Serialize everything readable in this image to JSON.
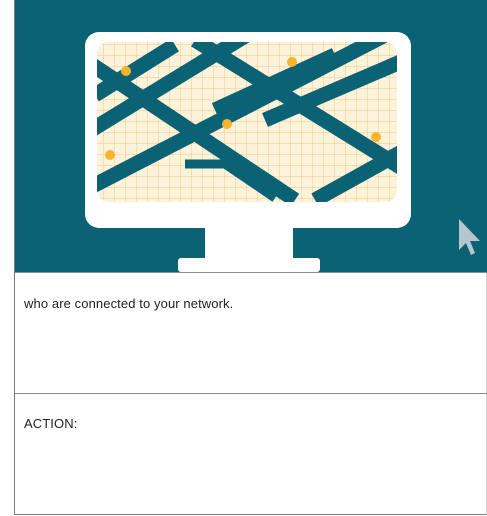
{
  "illustration": {
    "icon": "monitor-network-icon",
    "colors": {
      "background": "#0c6275",
      "monitor": "#ffffff",
      "screen_grid": "#f5ddb0",
      "paths": "#0c6275",
      "nodes": "#f6b52a"
    }
  },
  "cursor_icon": "mouse-pointer-icon",
  "sections": {
    "description": "who are connected to your network.",
    "action_label": "ACTION:"
  }
}
